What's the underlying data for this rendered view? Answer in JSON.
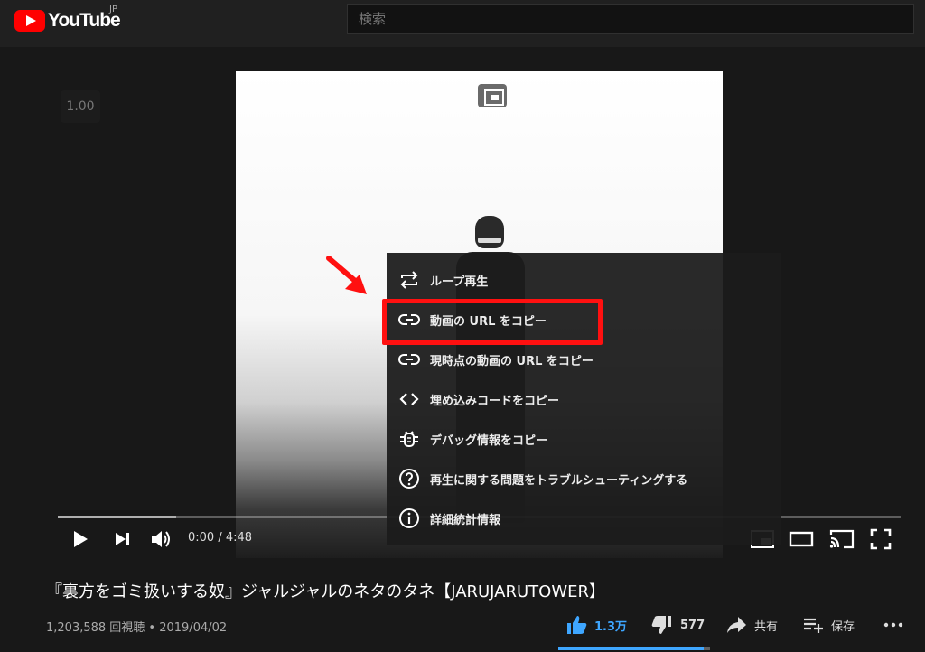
{
  "header": {
    "logo_text": "YouTube",
    "region": "JP",
    "search_placeholder": "検索"
  },
  "player": {
    "speed_badge": "1.00",
    "time_display": "0:00 / 4:48",
    "progress_loaded_fraction": 0.14,
    "controls": [
      "play-icon",
      "next-icon",
      "volume-icon",
      "miniplayer-icon",
      "theater-icon",
      "cast-icon",
      "fullscreen-icon"
    ]
  },
  "context_menu": {
    "items": [
      {
        "label": "ループ再生",
        "icon": "loop-icon"
      },
      {
        "label": "動画の URL をコピー",
        "icon": "link-icon"
      },
      {
        "label": "現時点の動画の URL をコピー",
        "icon": "link-icon"
      },
      {
        "label": "埋め込みコードをコピー",
        "icon": "code-icon"
      },
      {
        "label": "デバッグ情報をコピー",
        "icon": "bug-icon"
      },
      {
        "label": "再生に関する問題をトラブルシューティングする",
        "icon": "help-icon"
      },
      {
        "label": "詳細統計情報",
        "icon": "info-icon"
      }
    ],
    "highlighted_index": 1
  },
  "video": {
    "title": "『裏方をゴミ扱いする奴』ジャルジャルのネタのタネ【JARUJARUTOWER】",
    "views_date": "1,203,588 回視聴 • 2019/04/02",
    "likes": "1.3万",
    "dislikes": "577",
    "share_label": "共有",
    "save_label": "保存",
    "like_ratio": 0.96
  },
  "colors": {
    "accent_blue": "#3ea6ff",
    "annotation_red": "#ff1010",
    "brand_red": "#ff0000"
  }
}
